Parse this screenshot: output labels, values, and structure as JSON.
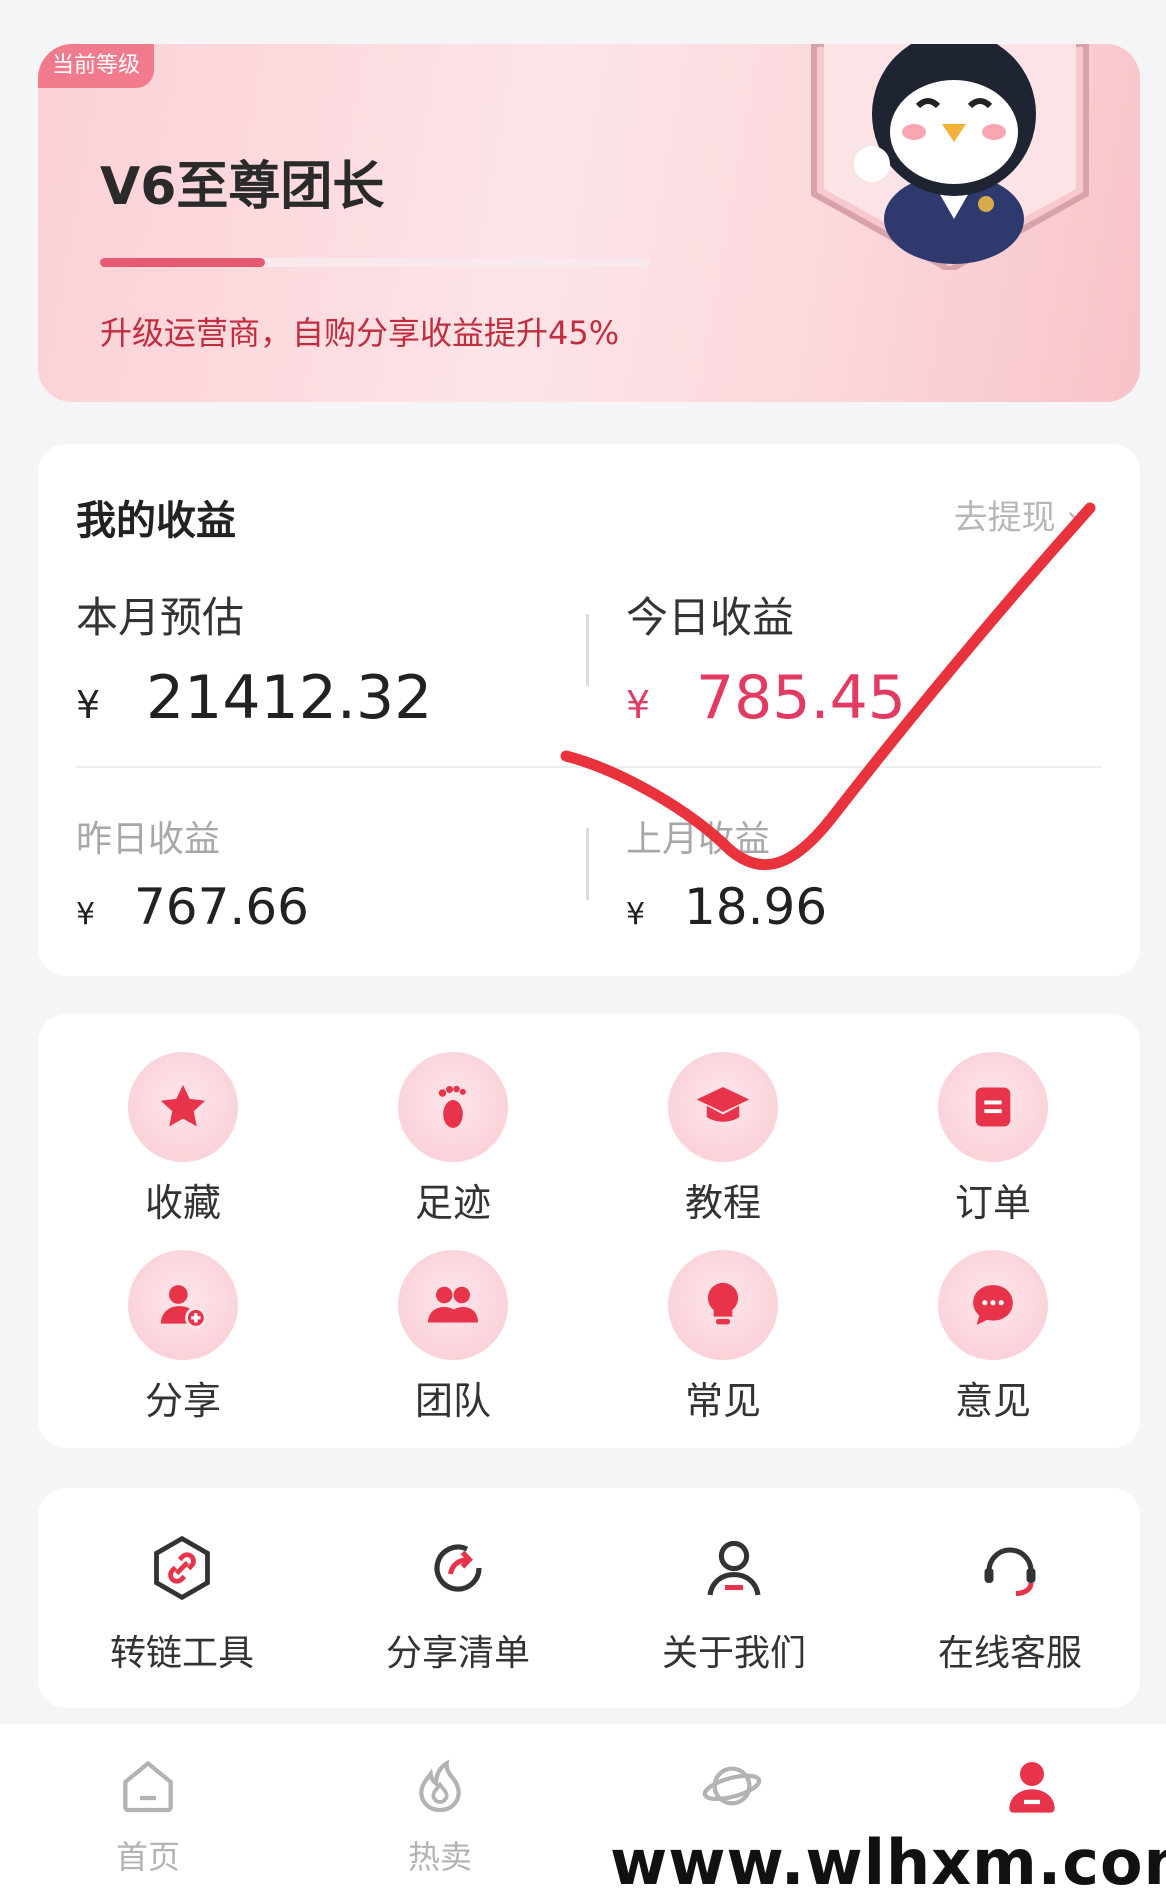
{
  "level": {
    "badge": "当前等级",
    "title": "V6至尊团长",
    "progress": 0.3,
    "description": "升级运营商，自购分享收益提升45%"
  },
  "earnings": {
    "title": "我的收益",
    "withdraw": "去提现",
    "this_month": {
      "label": "本月预估",
      "currency": "¥",
      "value": "21412.32"
    },
    "today": {
      "label": "今日收益",
      "currency": "¥",
      "value": "785.45"
    },
    "yesterday": {
      "label": "昨日收益",
      "currency": "¥",
      "value": "767.66"
    },
    "last_month": {
      "label": "上月收益",
      "currency": "¥",
      "value": "18.96"
    }
  },
  "grid": [
    {
      "label": "收藏",
      "icon": "star-icon"
    },
    {
      "label": "足迹",
      "icon": "footprint-icon"
    },
    {
      "label": "教程",
      "icon": "graduation-cap-icon"
    },
    {
      "label": "订单",
      "icon": "order-icon"
    },
    {
      "label": "分享",
      "icon": "add-user-icon"
    },
    {
      "label": "团队",
      "icon": "team-icon"
    },
    {
      "label": "常见",
      "icon": "lightbulb-icon"
    },
    {
      "label": "意见",
      "icon": "chat-bubble-icon"
    }
  ],
  "tools": [
    {
      "label": "转链工具",
      "icon": "link-icon"
    },
    {
      "label": "分享清单",
      "icon": "share-arrow-icon"
    },
    {
      "label": "关于我们",
      "icon": "person-icon"
    },
    {
      "label": "在线客服",
      "icon": "headset-icon"
    }
  ],
  "nav": [
    {
      "label": "首页",
      "icon": "home-icon"
    },
    {
      "label": "热卖",
      "icon": "flame-icon"
    },
    {
      "label": "",
      "icon": "planet-icon"
    },
    {
      "label": "",
      "icon": "profile-icon"
    }
  ],
  "watermark": "www.wlhxm.com",
  "colors": {
    "accent": "#e33a62",
    "badge": "#f17b8c",
    "annotation": "#e8323c"
  }
}
